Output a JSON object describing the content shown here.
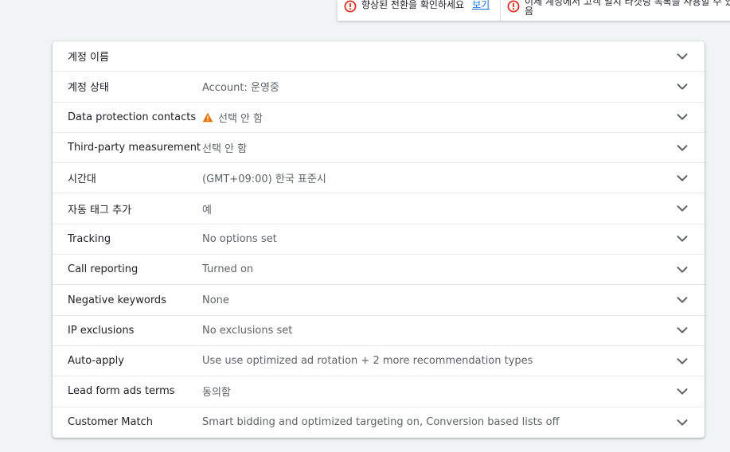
{
  "notifications": [
    {
      "text": "향상된 전환을 확인하세요",
      "link": "보기"
    },
    {
      "line1": "이제 계정에서 고객 일치 타겟팅 목록을 사용할 수 있",
      "line2": "음"
    }
  ],
  "settings": {
    "rows": [
      {
        "label": "계정 이름",
        "value": ""
      },
      {
        "label": "계정 상태",
        "value": "Account: 운영중"
      },
      {
        "label": "Data protection contacts",
        "value": "선택 안 함",
        "warning": true
      },
      {
        "label": "Third-party measurement",
        "value": "선택 안 함"
      },
      {
        "label": "시간대",
        "value": "(GMT+09:00) 한국 표준시"
      },
      {
        "label": "자동 태그 추가",
        "value": "예"
      },
      {
        "label": "Tracking",
        "value": "No options set"
      },
      {
        "label": "Call reporting",
        "value": "Turned on"
      },
      {
        "label": "Negative keywords",
        "value": "None"
      },
      {
        "label": "IP exclusions",
        "value": "No exclusions set"
      },
      {
        "label": "Auto-apply",
        "value": "Use use optimized ad rotation + 2 more recommendation types"
      },
      {
        "label": "Lead form ads terms",
        "value": "동의함"
      },
      {
        "label": "Customer Match",
        "value": "Smart bidding and optimized targeting on, Conversion based lists off"
      }
    ]
  },
  "colors": {
    "error": "#d93025",
    "warning": "#e37400",
    "link": "#1a73e8"
  },
  "icons": {
    "notification": "error-circle-icon",
    "row_expand": "chevron-down-icon",
    "warning": "warning-triangle-icon"
  }
}
